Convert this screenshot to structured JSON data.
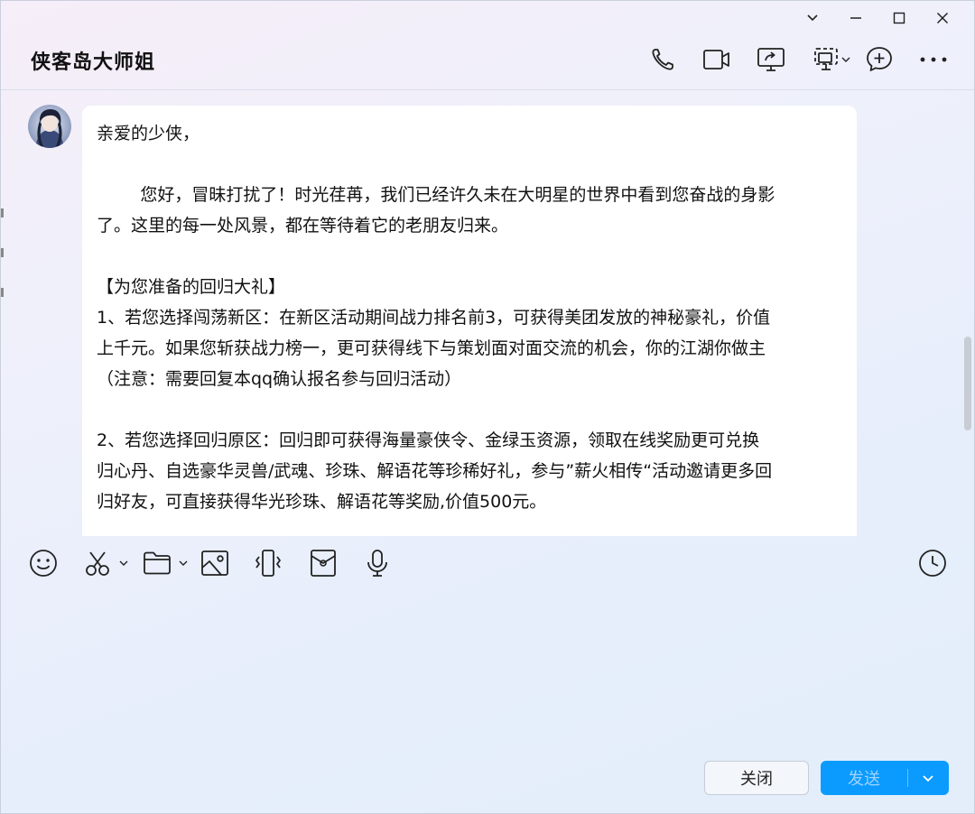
{
  "window": {
    "controls": [
      {
        "name": "chevron-down-icon"
      },
      {
        "name": "minimize-icon"
      },
      {
        "name": "maximize-icon"
      },
      {
        "name": "close-icon"
      }
    ]
  },
  "header": {
    "title": "侠客岛大师姐",
    "tools": [
      "phone-icon",
      "video-call-icon",
      "screen-share-icon",
      "remote-desktop-icon",
      "add-chat-icon",
      "more-icon"
    ]
  },
  "message": {
    "lines": [
      "亲爱的少侠，",
      "",
      "        您好，冒昧打扰了！时光荏苒，我们已经许久未在大明星的世界中看到您奋战的身影",
      "了。这里的每一处风景，都在等待着它的老朋友归来。",
      "",
      "【为您准备的回归大礼】",
      "1、若您选择闯荡新区：在新区活动期间战力排名前3，可获得美团发放的神秘豪礼，价值",
      "上千元。如果您斩获战力榜一，更可获得线下与策划面对面交流的机会，你的江湖你做主",
      "（注意：需要回复本qq确认报名参与回归活动）",
      "",
      "2、若您选择回归原区：回归即可获得海量豪侠令、金绿玉资源，领取在线奖励更可兑换",
      "归心丹、自选豪华灵兽/武魂、珍珠、解语花等珍稀好礼，参与”薪火相传“活动邀请更多回",
      "归好友，可直接获得华光珍珠、解语花等奖励,价值500元。"
    ]
  },
  "toolbar": {
    "items": [
      "emoji-icon",
      "scissors-icon",
      "folder-icon",
      "image-icon",
      "shake-icon",
      "red-packet-icon",
      "microphone-icon",
      "history-clock-icon"
    ]
  },
  "footer": {
    "close_label": "关闭",
    "send_label": "发送"
  },
  "colors": {
    "accent": "#0b9bff",
    "send_text_disabled": "#9ed3ff",
    "bubble_bg": "#ffffff"
  }
}
